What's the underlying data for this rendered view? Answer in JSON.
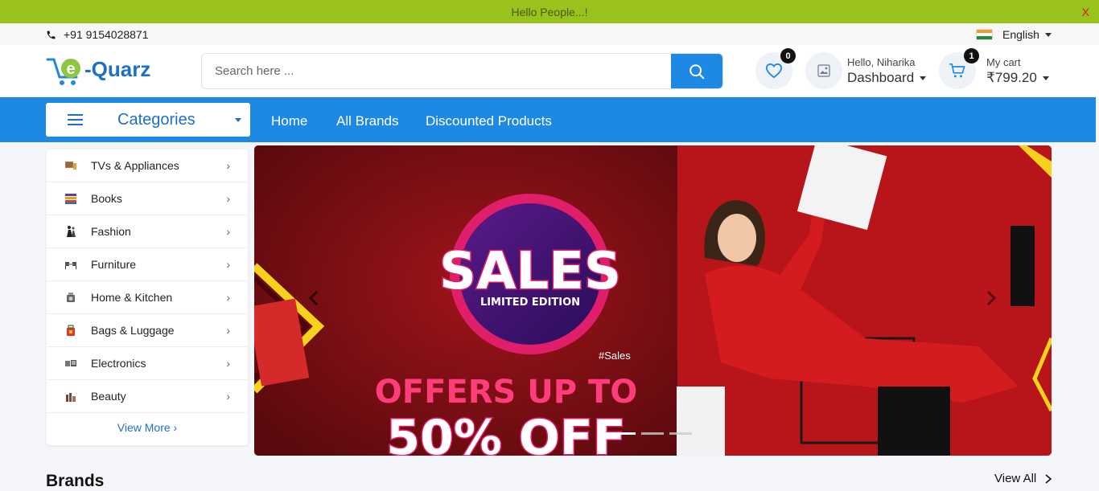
{
  "announcement": {
    "text": "Hello People...!",
    "close_label": "X"
  },
  "contact": {
    "phone": "+91 9154028871",
    "icon": "phone-icon"
  },
  "language": {
    "selected": "English",
    "flag": "india-flag-icon"
  },
  "brand": {
    "logo_text": "e-Quarz",
    "accent": "#1e88e5",
    "green": "#8dc63f"
  },
  "search": {
    "placeholder": "Search here ...",
    "value": "",
    "icon": "search-icon"
  },
  "wishlist": {
    "count": "0",
    "icon": "heart-icon"
  },
  "account": {
    "greeting": "Hello, Niharika",
    "label": "Dashboard",
    "icon": "avatar-image-icon"
  },
  "cart": {
    "count": "1",
    "label": "My cart",
    "total": "₹799.20",
    "icon": "cart-icon"
  },
  "nav": {
    "categories_label": "Categories",
    "links": [
      "Home",
      "All Brands",
      "Discounted Products"
    ]
  },
  "categories": {
    "items": [
      {
        "label": "TVs & Appliances",
        "icon": "tv-appliances-icon"
      },
      {
        "label": "Books",
        "icon": "books-icon"
      },
      {
        "label": "Fashion",
        "icon": "fashion-icon"
      },
      {
        "label": "Furniture",
        "icon": "furniture-icon"
      },
      {
        "label": "Home & Kitchen",
        "icon": "home-kitchen-icon"
      },
      {
        "label": "Bags & Luggage",
        "icon": "bags-luggage-icon"
      },
      {
        "label": "Electronics",
        "icon": "electronics-icon"
      },
      {
        "label": "Beauty",
        "icon": "beauty-icon"
      }
    ],
    "view_more": "View More"
  },
  "banner": {
    "headline": "SALES",
    "subline": "LIMITED EDITION",
    "hashtag": "#Sales",
    "offer_line1": "OFFERS UP TO",
    "offer_line2": "50% OFF",
    "slide_count": 3,
    "active_slide": 1
  },
  "brands_section": {
    "title": "Brands",
    "view_all": "View All"
  }
}
